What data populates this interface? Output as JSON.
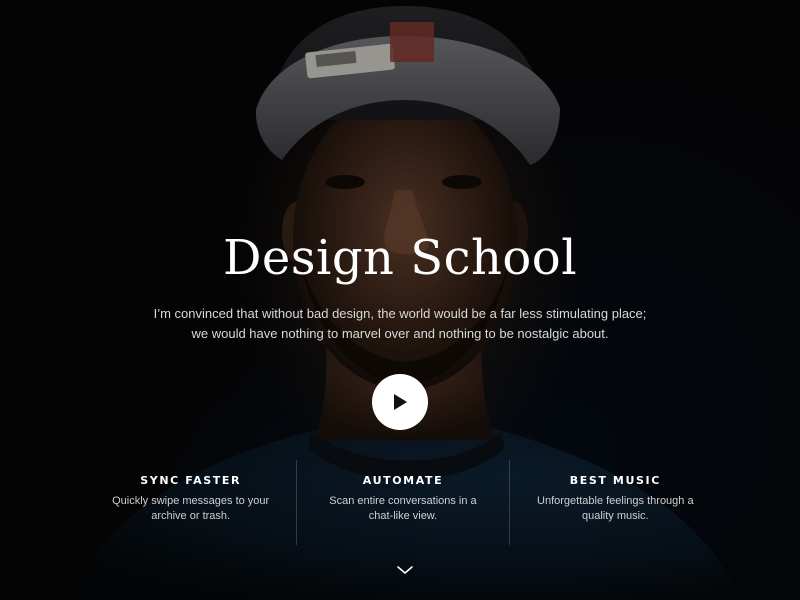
{
  "hero": {
    "title": "Design School",
    "subtitle": "I’m convinced that without bad design, the world would be a far less stimulating place; we would have nothing to marvel over and nothing to be nostalgic about.",
    "play_icon": "play-icon",
    "scroll_icon": "chevron-down-icon"
  },
  "features": [
    {
      "title": "SYNC FASTER",
      "description": "Quickly swipe messages to your archive or trash."
    },
    {
      "title": "AUTOMATE",
      "description": "Scan entire conversations in a chat-like view."
    },
    {
      "title": "BEST MUSIC",
      "description": "Unforgettable feelings through a quality music."
    }
  ],
  "colors": {
    "text_primary": "#ffffff",
    "text_secondary": "#d9d9d9",
    "background": "#060606",
    "play_button": "#ffffff"
  }
}
